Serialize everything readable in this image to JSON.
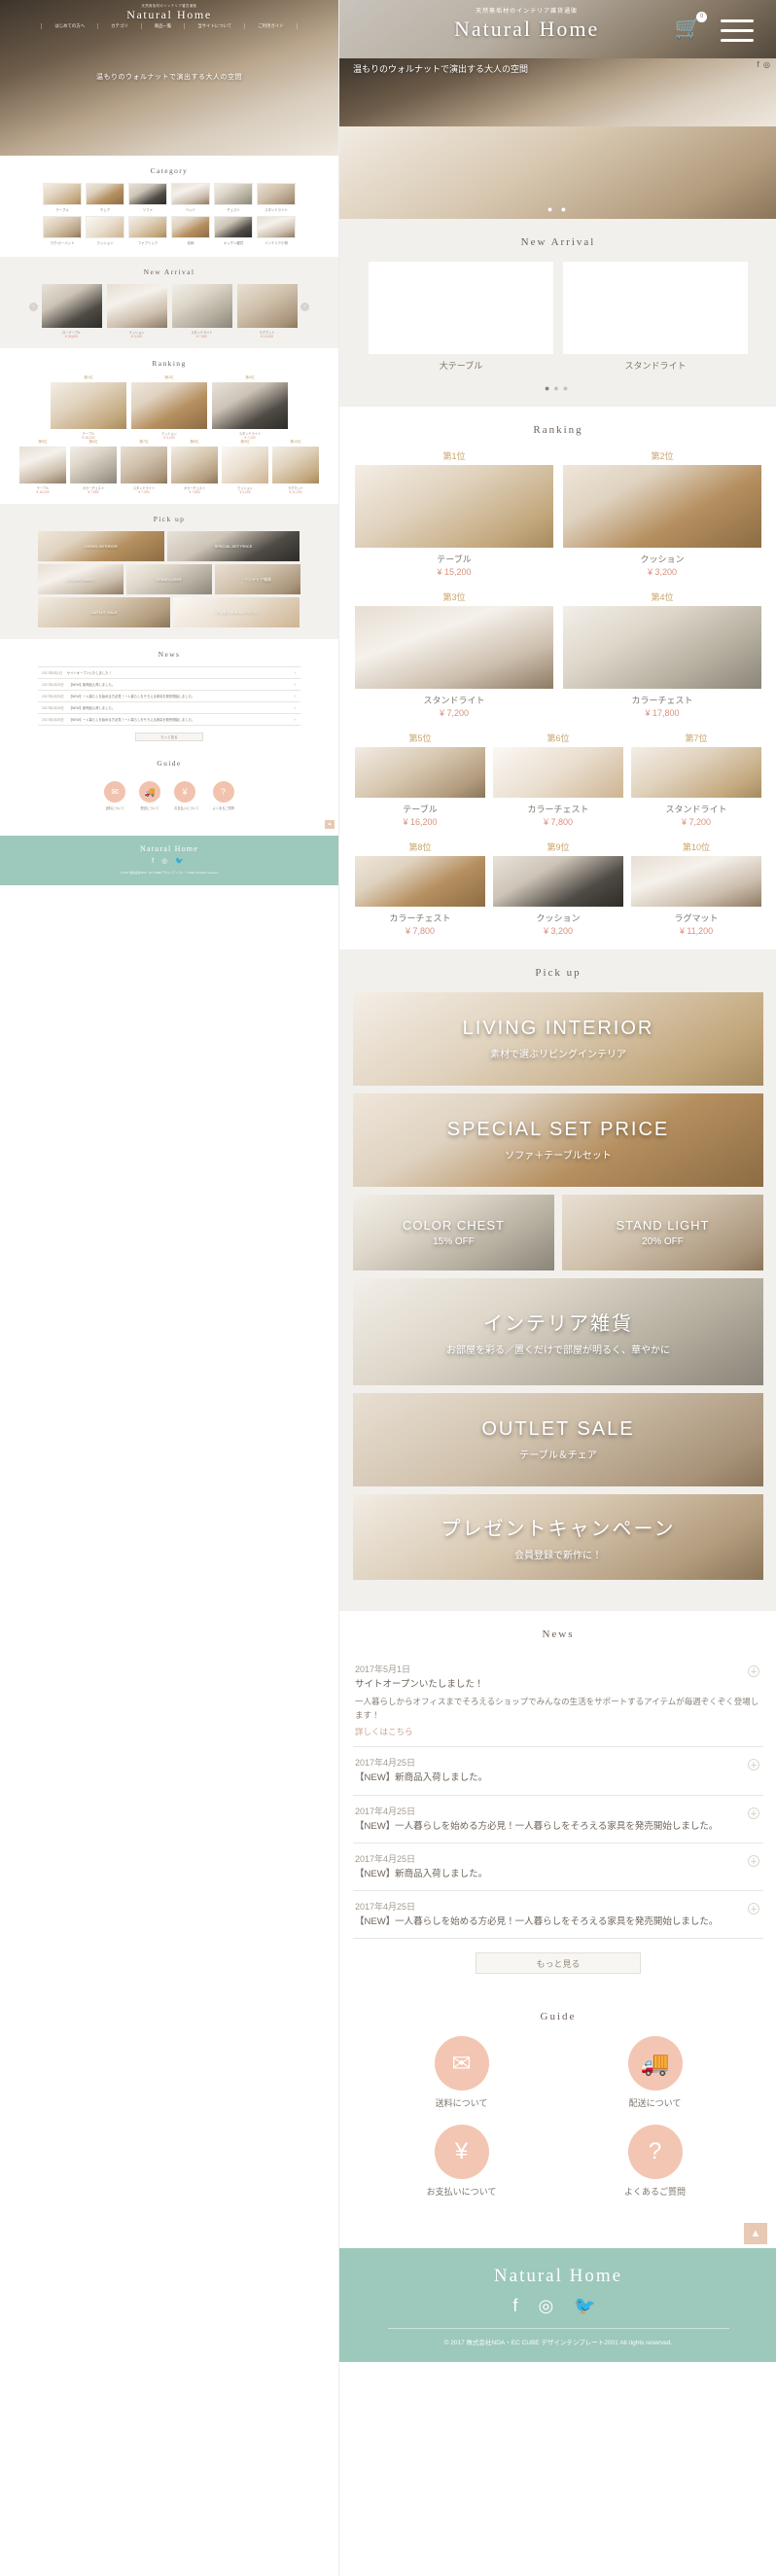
{
  "site": {
    "logo_sub": "天然無垢材のインテリア雑貨通販",
    "logo": "Natural Home",
    "hero_copy": "温もりのウォルナットで演出する大人の空間",
    "cart_count": "0"
  },
  "nav": {
    "items": [
      "はじめての方へ",
      "カテゴリ",
      "商品一覧",
      "当サイトについて",
      "ご利用ガイド"
    ]
  },
  "category": {
    "title": "Category",
    "items": [
      {
        "label": "テーブル"
      },
      {
        "label": "チェア"
      },
      {
        "label": "ソファ"
      },
      {
        "label": "ベッド"
      },
      {
        "label": "チェスト"
      },
      {
        "label": "スタンドライト"
      },
      {
        "label": "ラグ・カーペット"
      },
      {
        "label": "クッション"
      },
      {
        "label": "ファブリック"
      },
      {
        "label": "収納"
      },
      {
        "label": "キッチン雑貨"
      },
      {
        "label": "インテリア小物"
      }
    ]
  },
  "new_arrival": {
    "title": "New Arrival",
    "items": [
      {
        "name": "ローテーブル",
        "price": "¥ 26,800"
      },
      {
        "name": "クッション",
        "price": "¥ 3,200"
      },
      {
        "name": "スタンドライト",
        "price": "¥ 7,500"
      },
      {
        "name": "ラグマット",
        "price": "¥ 12,000"
      }
    ],
    "mobile_items": [
      {
        "name": "大テーブル"
      },
      {
        "name": "スタンドライト"
      }
    ],
    "pager": [
      "1",
      "2",
      "3"
    ],
    "pager_active": "1"
  },
  "ranking": {
    "title": "Ranking",
    "top": [
      {
        "rank": "第1位",
        "name": "テーブル",
        "price": "¥ 15,200"
      },
      {
        "rank": "第2位",
        "name": "クッション",
        "price": "¥ 3,200"
      },
      {
        "rank": "第3位",
        "name": "スタンドライト",
        "price": "¥ 7,200"
      }
    ],
    "second": [
      {
        "rank": "第3位",
        "name": "スタンドライト",
        "price": "¥ 7,200"
      },
      {
        "rank": "第4位",
        "name": "カラーチェスト",
        "price": "¥ 17,800"
      }
    ],
    "rest": [
      {
        "rank": "第5位",
        "name": "テーブル",
        "price": "¥ 16,200"
      },
      {
        "rank": "第6位",
        "name": "カラーチェスト",
        "price": "¥ 7,800"
      },
      {
        "rank": "第7位",
        "name": "スタンドライト",
        "price": "¥ 7,200"
      },
      {
        "rank": "第8位",
        "name": "カラーチェスト",
        "price": "¥ 7,800"
      },
      {
        "rank": "第9位",
        "name": "クッション",
        "price": "¥ 3,200"
      },
      {
        "rank": "第10位",
        "name": "ラグマット",
        "price": "¥ 11,200"
      }
    ],
    "mobile_rows": [
      [
        {
          "rank": "第1位",
          "name": "テーブル",
          "price": "¥ 15,200"
        },
        {
          "rank": "第2位",
          "name": "クッション",
          "price": "¥ 3,200"
        }
      ],
      [
        {
          "rank": "第3位",
          "name": "スタンドライト",
          "price": "¥ 7,200"
        },
        {
          "rank": "第4位",
          "name": "カラーチェスト",
          "price": "¥ 17,800"
        }
      ],
      [
        {
          "rank": "第5位",
          "name": "テーブル",
          "price": "¥ 16,200"
        },
        {
          "rank": "第6位",
          "name": "カラーチェスト",
          "price": "¥ 7,800"
        },
        {
          "rank": "第7位",
          "name": "スタンドライト",
          "price": "¥ 7,200"
        }
      ],
      [
        {
          "rank": "第8位",
          "name": "カラーチェスト",
          "price": "¥ 7,800"
        },
        {
          "rank": "第9位",
          "name": "クッション",
          "price": "¥ 3,200"
        },
        {
          "rank": "第10位",
          "name": "ラグマット",
          "price": "¥ 11,200"
        }
      ]
    ]
  },
  "pickup": {
    "title": "Pick up",
    "banners": [
      {
        "title": "LIVING INTERIOR",
        "sub": "素材で選ぶリビングインテリア"
      },
      {
        "title": "SPECIAL SET PRICE",
        "sub": "ソファ＋テーブルセット"
      },
      {
        "title": "COLOR CHEST",
        "sub": "15% OFF"
      },
      {
        "title": "STAND LIGHT",
        "sub": "20% OFF"
      },
      {
        "title": "インテリア雑貨",
        "sub": "お部屋を彩る／置くだけで部屋が明るく、華やかに"
      },
      {
        "title": "OUTLET SALE",
        "sub": "テーブル＆チェア"
      },
      {
        "title": "プレゼントキャンペーン",
        "sub": "会員登録で新作に！"
      }
    ]
  },
  "news": {
    "title": "News",
    "more_label": "もっと見る",
    "items": [
      {
        "date": "2017年5月1日",
        "title": "サイトオープンいたしました！",
        "body": "一人暮らしからオフィスまでそろえるショップでみんなの生活をサポートするアイテムが毎週ぞくぞく登場します！",
        "link": "詳しくはこちら"
      },
      {
        "date": "2017年4月25日",
        "title": "【NEW】新商品入荷しました。",
        "body": ""
      },
      {
        "date": "2017年4月25日",
        "title": "【NEW】一人暮らしを始める方必見！一人暮らしをそろえる家具を発売開始しました。",
        "body": ""
      },
      {
        "date": "2017年4月25日",
        "title": "【NEW】新商品入荷しました。",
        "body": ""
      },
      {
        "date": "2017年4月25日",
        "title": "【NEW】一人暮らしを始める方必見！一人暮らしをそろえる家具を発売開始しました。",
        "body": ""
      }
    ]
  },
  "guide": {
    "title": "Guide",
    "items": [
      {
        "label": "送料について",
        "icon": "package-icon",
        "glyph": "✉"
      },
      {
        "label": "配送について",
        "icon": "truck-icon",
        "glyph": "🚚"
      },
      {
        "label": "お支払いについて",
        "icon": "yen-icon",
        "glyph": "¥"
      },
      {
        "label": "よくあるご質問",
        "icon": "question-icon",
        "glyph": "?"
      }
    ]
  },
  "footer": {
    "logo": "Natural Home",
    "social": [
      "facebook-icon",
      "instagram-icon",
      "twitter-icon"
    ],
    "copyright": "© 2017 株式会社NDA・EC CUBE デザインテンプレート2001 All rights reserved."
  },
  "colors": {
    "accent": "#9dc8bc",
    "price": "#d98f7e",
    "rank": "#c9a46a",
    "guide_circle": "#f1c3ae"
  },
  "scroll_top_label": "▲"
}
